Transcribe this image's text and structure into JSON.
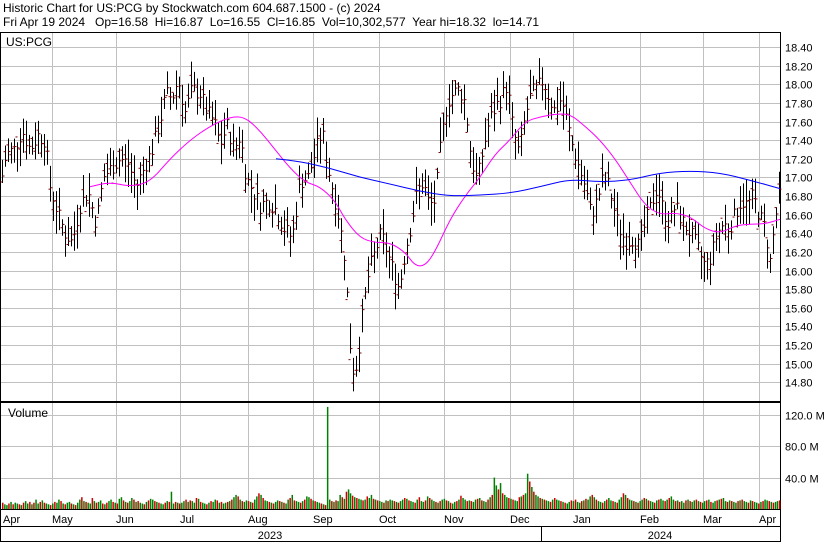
{
  "header": {
    "line1": "Historic Chart for US:PCG by Stockwatch.com 604.687.1500 - (c) 2024",
    "line2": "Fri Apr 19 2024   Op=16.58  Hi=16.87  Lo=16.55  Cl=16.85  Vol=10,302,577  Year hi=18.32  lo=14.71"
  },
  "chart_data": [
    {
      "type": "line",
      "panel": "price",
      "symbol_label": "US:PCG",
      "ylim": [
        14.6,
        18.55
      ],
      "y_ticks": [
        "18.40",
        "18.20",
        "18.00",
        "17.80",
        "17.60",
        "17.40",
        "17.20",
        "17.00",
        "16.80",
        "16.60",
        "16.40",
        "16.20",
        "16.00",
        "15.80",
        "15.60",
        "15.40",
        "15.20",
        "15.00",
        "14.80"
      ],
      "grid": true,
      "colors": {
        "bars": "#800000",
        "ma_short": "#ff00ff",
        "ma_long": "#0000ff",
        "grid": "#c0c0c0"
      },
      "x_labels": [
        "Apr",
        "May",
        "Jun",
        "Jul",
        "Aug",
        "Sep",
        "Oct",
        "Nov",
        "Dec",
        "Jan",
        "Feb",
        "Mar",
        "Apr"
      ],
      "years": [
        "2023",
        "2024"
      ],
      "price_path": [
        {
          "x": 0,
          "y": 16.9
        },
        {
          "x": 6,
          "y": 17.25
        },
        {
          "x": 14,
          "y": 17.3
        },
        {
          "x": 22,
          "y": 17.5
        },
        {
          "x": 30,
          "y": 17.3
        },
        {
          "x": 38,
          "y": 17.45
        },
        {
          "x": 45,
          "y": 17.4
        },
        {
          "x": 50,
          "y": 16.9
        },
        {
          "x": 58,
          "y": 16.6
        },
        {
          "x": 65,
          "y": 16.4
        },
        {
          "x": 72,
          "y": 16.3
        },
        {
          "x": 80,
          "y": 16.7
        },
        {
          "x": 88,
          "y": 16.85
        },
        {
          "x": 96,
          "y": 16.5
        },
        {
          "x": 103,
          "y": 17.0
        },
        {
          "x": 111,
          "y": 17.1
        },
        {
          "x": 120,
          "y": 17.2
        },
        {
          "x": 128,
          "y": 17.15
        },
        {
          "x": 136,
          "y": 16.9
        },
        {
          "x": 144,
          "y": 17.1
        },
        {
          "x": 152,
          "y": 17.3
        },
        {
          "x": 160,
          "y": 17.6
        },
        {
          "x": 166,
          "y": 17.9
        },
        {
          "x": 172,
          "y": 17.85
        },
        {
          "x": 178,
          "y": 18.05
        },
        {
          "x": 185,
          "y": 17.7
        },
        {
          "x": 192,
          "y": 17.95
        },
        {
          "x": 200,
          "y": 17.9
        },
        {
          "x": 207,
          "y": 17.7
        },
        {
          "x": 214,
          "y": 17.6
        },
        {
          "x": 220,
          "y": 17.35
        },
        {
          "x": 227,
          "y": 17.55
        },
        {
          "x": 234,
          "y": 17.3
        },
        {
          "x": 240,
          "y": 17.45
        },
        {
          "x": 246,
          "y": 17.0
        },
        {
          "x": 253,
          "y": 16.85
        },
        {
          "x": 260,
          "y": 16.7
        },
        {
          "x": 268,
          "y": 16.75
        },
        {
          "x": 276,
          "y": 16.65
        },
        {
          "x": 284,
          "y": 16.45
        },
        {
          "x": 292,
          "y": 16.35
        },
        {
          "x": 300,
          "y": 16.95
        },
        {
          "x": 308,
          "y": 17.0
        },
        {
          "x": 316,
          "y": 17.3
        },
        {
          "x": 322,
          "y": 17.5
        },
        {
          "x": 327,
          "y": 17.15
        },
        {
          "x": 333,
          "y": 16.85
        },
        {
          "x": 339,
          "y": 16.55
        },
        {
          "x": 345,
          "y": 16.1
        },
        {
          "x": 350,
          "y": 15.2
        },
        {
          "x": 354,
          "y": 14.85
        },
        {
          "x": 358,
          "y": 15.1
        },
        {
          "x": 363,
          "y": 15.6
        },
        {
          "x": 369,
          "y": 16.0
        },
        {
          "x": 375,
          "y": 16.2
        },
        {
          "x": 381,
          "y": 16.4
        },
        {
          "x": 387,
          "y": 16.2
        },
        {
          "x": 393,
          "y": 16.0
        },
        {
          "x": 399,
          "y": 15.8
        },
        {
          "x": 405,
          "y": 16.2
        },
        {
          "x": 411,
          "y": 16.5
        },
        {
          "x": 417,
          "y": 16.85
        },
        {
          "x": 423,
          "y": 16.95
        },
        {
          "x": 429,
          "y": 16.7
        },
        {
          "x": 435,
          "y": 16.75
        },
        {
          "x": 441,
          "y": 17.4
        },
        {
          "x": 447,
          "y": 17.8
        },
        {
          "x": 453,
          "y": 17.9
        },
        {
          "x": 459,
          "y": 17.95
        },
        {
          "x": 465,
          "y": 17.8
        },
        {
          "x": 471,
          "y": 17.2
        },
        {
          "x": 477,
          "y": 16.95
        },
        {
          "x": 483,
          "y": 17.3
        },
        {
          "x": 489,
          "y": 17.6
        },
        {
          "x": 495,
          "y": 17.75
        },
        {
          "x": 501,
          "y": 17.85
        },
        {
          "x": 507,
          "y": 18.0
        },
        {
          "x": 513,
          "y": 17.5
        },
        {
          "x": 519,
          "y": 17.25
        },
        {
          "x": 525,
          "y": 17.65
        },
        {
          "x": 531,
          "y": 17.9
        },
        {
          "x": 537,
          "y": 17.95
        },
        {
          "x": 543,
          "y": 18.05
        },
        {
          "x": 549,
          "y": 17.85
        },
        {
          "x": 555,
          "y": 17.7
        },
        {
          "x": 561,
          "y": 17.85
        },
        {
          "x": 567,
          "y": 17.6
        },
        {
          "x": 573,
          "y": 17.3
        },
        {
          "x": 579,
          "y": 17.1
        },
        {
          "x": 585,
          "y": 16.9
        },
        {
          "x": 591,
          "y": 16.6
        },
        {
          "x": 597,
          "y": 16.75
        },
        {
          "x": 603,
          "y": 17.0
        },
        {
          "x": 609,
          "y": 16.9
        },
        {
          "x": 615,
          "y": 16.6
        },
        {
          "x": 621,
          "y": 16.4
        },
        {
          "x": 627,
          "y": 16.3
        },
        {
          "x": 633,
          "y": 16.35
        },
        {
          "x": 639,
          "y": 16.25
        },
        {
          "x": 645,
          "y": 16.5
        },
        {
          "x": 651,
          "y": 16.7
        },
        {
          "x": 657,
          "y": 16.9
        },
        {
          "x": 663,
          "y": 16.65
        },
        {
          "x": 669,
          "y": 16.5
        },
        {
          "x": 675,
          "y": 16.7
        },
        {
          "x": 681,
          "y": 16.55
        },
        {
          "x": 687,
          "y": 16.45
        },
        {
          "x": 693,
          "y": 16.35
        },
        {
          "x": 699,
          "y": 16.2
        },
        {
          "x": 705,
          "y": 16.05
        },
        {
          "x": 711,
          "y": 16.15
        },
        {
          "x": 717,
          "y": 16.4
        },
        {
          "x": 723,
          "y": 16.5
        },
        {
          "x": 729,
          "y": 16.45
        },
        {
          "x": 735,
          "y": 16.6
        },
        {
          "x": 741,
          "y": 16.75
        },
        {
          "x": 747,
          "y": 16.7
        },
        {
          "x": 753,
          "y": 16.8
        },
        {
          "x": 759,
          "y": 16.6
        },
        {
          "x": 765,
          "y": 16.45
        },
        {
          "x": 770,
          "y": 16.1
        },
        {
          "x": 775,
          "y": 16.55
        },
        {
          "x": 780,
          "y": 16.85
        }
      ],
      "ma_short": [
        {
          "x": 90,
          "y": 16.9
        },
        {
          "x": 110,
          "y": 16.95
        },
        {
          "x": 130,
          "y": 16.9
        },
        {
          "x": 150,
          "y": 16.95
        },
        {
          "x": 170,
          "y": 17.2
        },
        {
          "x": 190,
          "y": 17.4
        },
        {
          "x": 210,
          "y": 17.55
        },
        {
          "x": 230,
          "y": 17.65
        },
        {
          "x": 245,
          "y": 17.65
        },
        {
          "x": 260,
          "y": 17.5
        },
        {
          "x": 275,
          "y": 17.3
        },
        {
          "x": 290,
          "y": 17.1
        },
        {
          "x": 305,
          "y": 16.95
        },
        {
          "x": 320,
          "y": 16.9
        },
        {
          "x": 335,
          "y": 16.75
        },
        {
          "x": 345,
          "y": 16.55
        },
        {
          "x": 360,
          "y": 16.35
        },
        {
          "x": 375,
          "y": 16.3
        },
        {
          "x": 390,
          "y": 16.3
        },
        {
          "x": 405,
          "y": 16.2
        },
        {
          "x": 415,
          "y": 16.05
        },
        {
          "x": 425,
          "y": 16.05
        },
        {
          "x": 435,
          "y": 16.2
        },
        {
          "x": 450,
          "y": 16.55
        },
        {
          "x": 465,
          "y": 16.8
        },
        {
          "x": 480,
          "y": 17.0
        },
        {
          "x": 495,
          "y": 17.25
        },
        {
          "x": 510,
          "y": 17.4
        },
        {
          "x": 525,
          "y": 17.6
        },
        {
          "x": 540,
          "y": 17.65
        },
        {
          "x": 555,
          "y": 17.68
        },
        {
          "x": 570,
          "y": 17.68
        },
        {
          "x": 585,
          "y": 17.55
        },
        {
          "x": 600,
          "y": 17.4
        },
        {
          "x": 615,
          "y": 17.2
        },
        {
          "x": 630,
          "y": 16.95
        },
        {
          "x": 645,
          "y": 16.7
        },
        {
          "x": 660,
          "y": 16.6
        },
        {
          "x": 675,
          "y": 16.62
        },
        {
          "x": 690,
          "y": 16.58
        },
        {
          "x": 705,
          "y": 16.45
        },
        {
          "x": 720,
          "y": 16.4
        },
        {
          "x": 735,
          "y": 16.48
        },
        {
          "x": 750,
          "y": 16.5
        },
        {
          "x": 765,
          "y": 16.5
        },
        {
          "x": 780,
          "y": 16.55
        }
      ],
      "ma_long": [
        {
          "x": 276,
          "y": 17.2
        },
        {
          "x": 300,
          "y": 17.17
        },
        {
          "x": 330,
          "y": 17.1
        },
        {
          "x": 360,
          "y": 17.0
        },
        {
          "x": 390,
          "y": 16.93
        },
        {
          "x": 420,
          "y": 16.85
        },
        {
          "x": 450,
          "y": 16.8
        },
        {
          "x": 480,
          "y": 16.81
        },
        {
          "x": 510,
          "y": 16.83
        },
        {
          "x": 540,
          "y": 16.9
        },
        {
          "x": 570,
          "y": 16.98
        },
        {
          "x": 600,
          "y": 16.95
        },
        {
          "x": 630,
          "y": 16.97
        },
        {
          "x": 660,
          "y": 17.05
        },
        {
          "x": 690,
          "y": 17.07
        },
        {
          "x": 720,
          "y": 17.05
        },
        {
          "x": 750,
          "y": 16.97
        },
        {
          "x": 780,
          "y": 16.88
        }
      ]
    },
    {
      "type": "bar",
      "panel": "volume",
      "title": "Volume",
      "ylim": [
        0,
        135
      ],
      "y_ticks": [
        "120.0 M",
        "80.0 M",
        "40.0 M"
      ],
      "colors": {
        "up": "#008000",
        "down": "#d00000"
      },
      "values": [
        8,
        6,
        5,
        7,
        9,
        6,
        8,
        7,
        6,
        5,
        8,
        10,
        7,
        9,
        6,
        8,
        12,
        7,
        9,
        11,
        8,
        7,
        6,
        5,
        7,
        9,
        8,
        12,
        10,
        7,
        6,
        8,
        9,
        7,
        6,
        5,
        8,
        12,
        15,
        10,
        9,
        8,
        7,
        14,
        10,
        8,
        9,
        11,
        7,
        6,
        8,
        10,
        12,
        9,
        8,
        7,
        13,
        15,
        11,
        9,
        8,
        10,
        14,
        12,
        9,
        10,
        8,
        7,
        6,
        9,
        11,
        13,
        12,
        10,
        9,
        8,
        7,
        6,
        8,
        10,
        9,
        22,
        7,
        9,
        8,
        7,
        8,
        10,
        12,
        9,
        11,
        10,
        8,
        14,
        13,
        9,
        8,
        7,
        6,
        8,
        10,
        9,
        12,
        11,
        8,
        9,
        7,
        8,
        9,
        10,
        12,
        15,
        18,
        16,
        12,
        10,
        9,
        11,
        10,
        9,
        8,
        12,
        16,
        20,
        18,
        14,
        11,
        10,
        9,
        8,
        7,
        9,
        11,
        10,
        9,
        8,
        7,
        12,
        14,
        18,
        11,
        10,
        9,
        8,
        10,
        12,
        16,
        15,
        13,
        11,
        10,
        9,
        8,
        7,
        6,
        5,
        130,
        12,
        10,
        9,
        11,
        10,
        18,
        15,
        13,
        22,
        25,
        20,
        17,
        15,
        14,
        13,
        12,
        11,
        12,
        16,
        14,
        18,
        13,
        12,
        11,
        10,
        9,
        8,
        11,
        10,
        12,
        11,
        10,
        9,
        8,
        10,
        12,
        14,
        13,
        11,
        10,
        9,
        8,
        12,
        15,
        10,
        9,
        11,
        16,
        14,
        12,
        10,
        9,
        8,
        10,
        12,
        13,
        11,
        10,
        8,
        7,
        9,
        10,
        12,
        17,
        14,
        12,
        10,
        11,
        10,
        9,
        12,
        13,
        14,
        11,
        10,
        9,
        12,
        15,
        18,
        40,
        30,
        25,
        33,
        20,
        18,
        15,
        14,
        13,
        12,
        11,
        10,
        15,
        16,
        18,
        20,
        45,
        35,
        28,
        22,
        18,
        16,
        14,
        13,
        12,
        11,
        10,
        9,
        12,
        14,
        12,
        11,
        10,
        9,
        8,
        7,
        9,
        11,
        10,
        12,
        9,
        8,
        10,
        11,
        13,
        12,
        16,
        18,
        15,
        12,
        10,
        9,
        8,
        10,
        12,
        14,
        11,
        10,
        9,
        8,
        12,
        15,
        20,
        18,
        14,
        12,
        11,
        10,
        9,
        8,
        10,
        12,
        14,
        13,
        11,
        10,
        9,
        8,
        11,
        12,
        13,
        11,
        10,
        12,
        14,
        16,
        12,
        10,
        11,
        9,
        10,
        8,
        11,
        12,
        10,
        9,
        11,
        12,
        10,
        9,
        8,
        10,
        11,
        12,
        9,
        8,
        10,
        11,
        12,
        13,
        14,
        10,
        9,
        11,
        10,
        9,
        8,
        10,
        11,
        12,
        10,
        9,
        8,
        11,
        10,
        9,
        8,
        7,
        9,
        10,
        12,
        11,
        10,
        9,
        8,
        9,
        10,
        11
      ]
    }
  ]
}
